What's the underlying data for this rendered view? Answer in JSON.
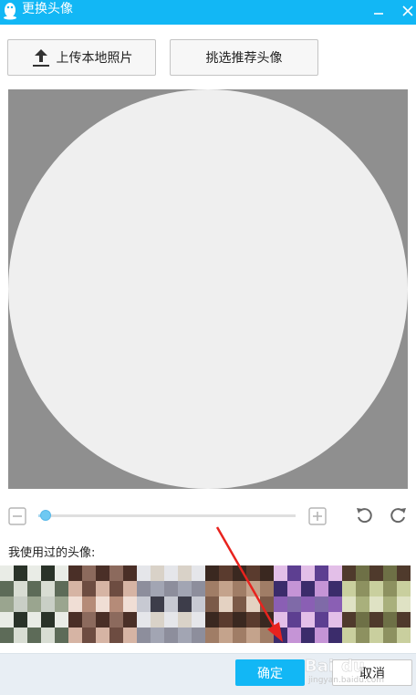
{
  "window": {
    "title": "更换头像",
    "accent_color": "#12b7f5",
    "icons": [
      "qq-penguin-icon",
      "minimize-icon",
      "close-icon"
    ]
  },
  "toolbar": {
    "upload_label": "上传本地照片",
    "recommend_label": "挑选推荐头像",
    "upload_icon": "upload-icon"
  },
  "editor": {
    "background_color": "#8f8f8f",
    "circle_color": "#efefef",
    "zoom_level": 0.02,
    "icons": [
      "zoom-out-icon",
      "zoom-in-icon",
      "rotate-left-icon",
      "rotate-right-icon"
    ]
  },
  "history": {
    "label": "我使用过的头像:"
  },
  "footer": {
    "ok_label": "确定",
    "cancel_label": "取消"
  },
  "watermark": {
    "text": "Baidu jingyan.baidu.com"
  }
}
